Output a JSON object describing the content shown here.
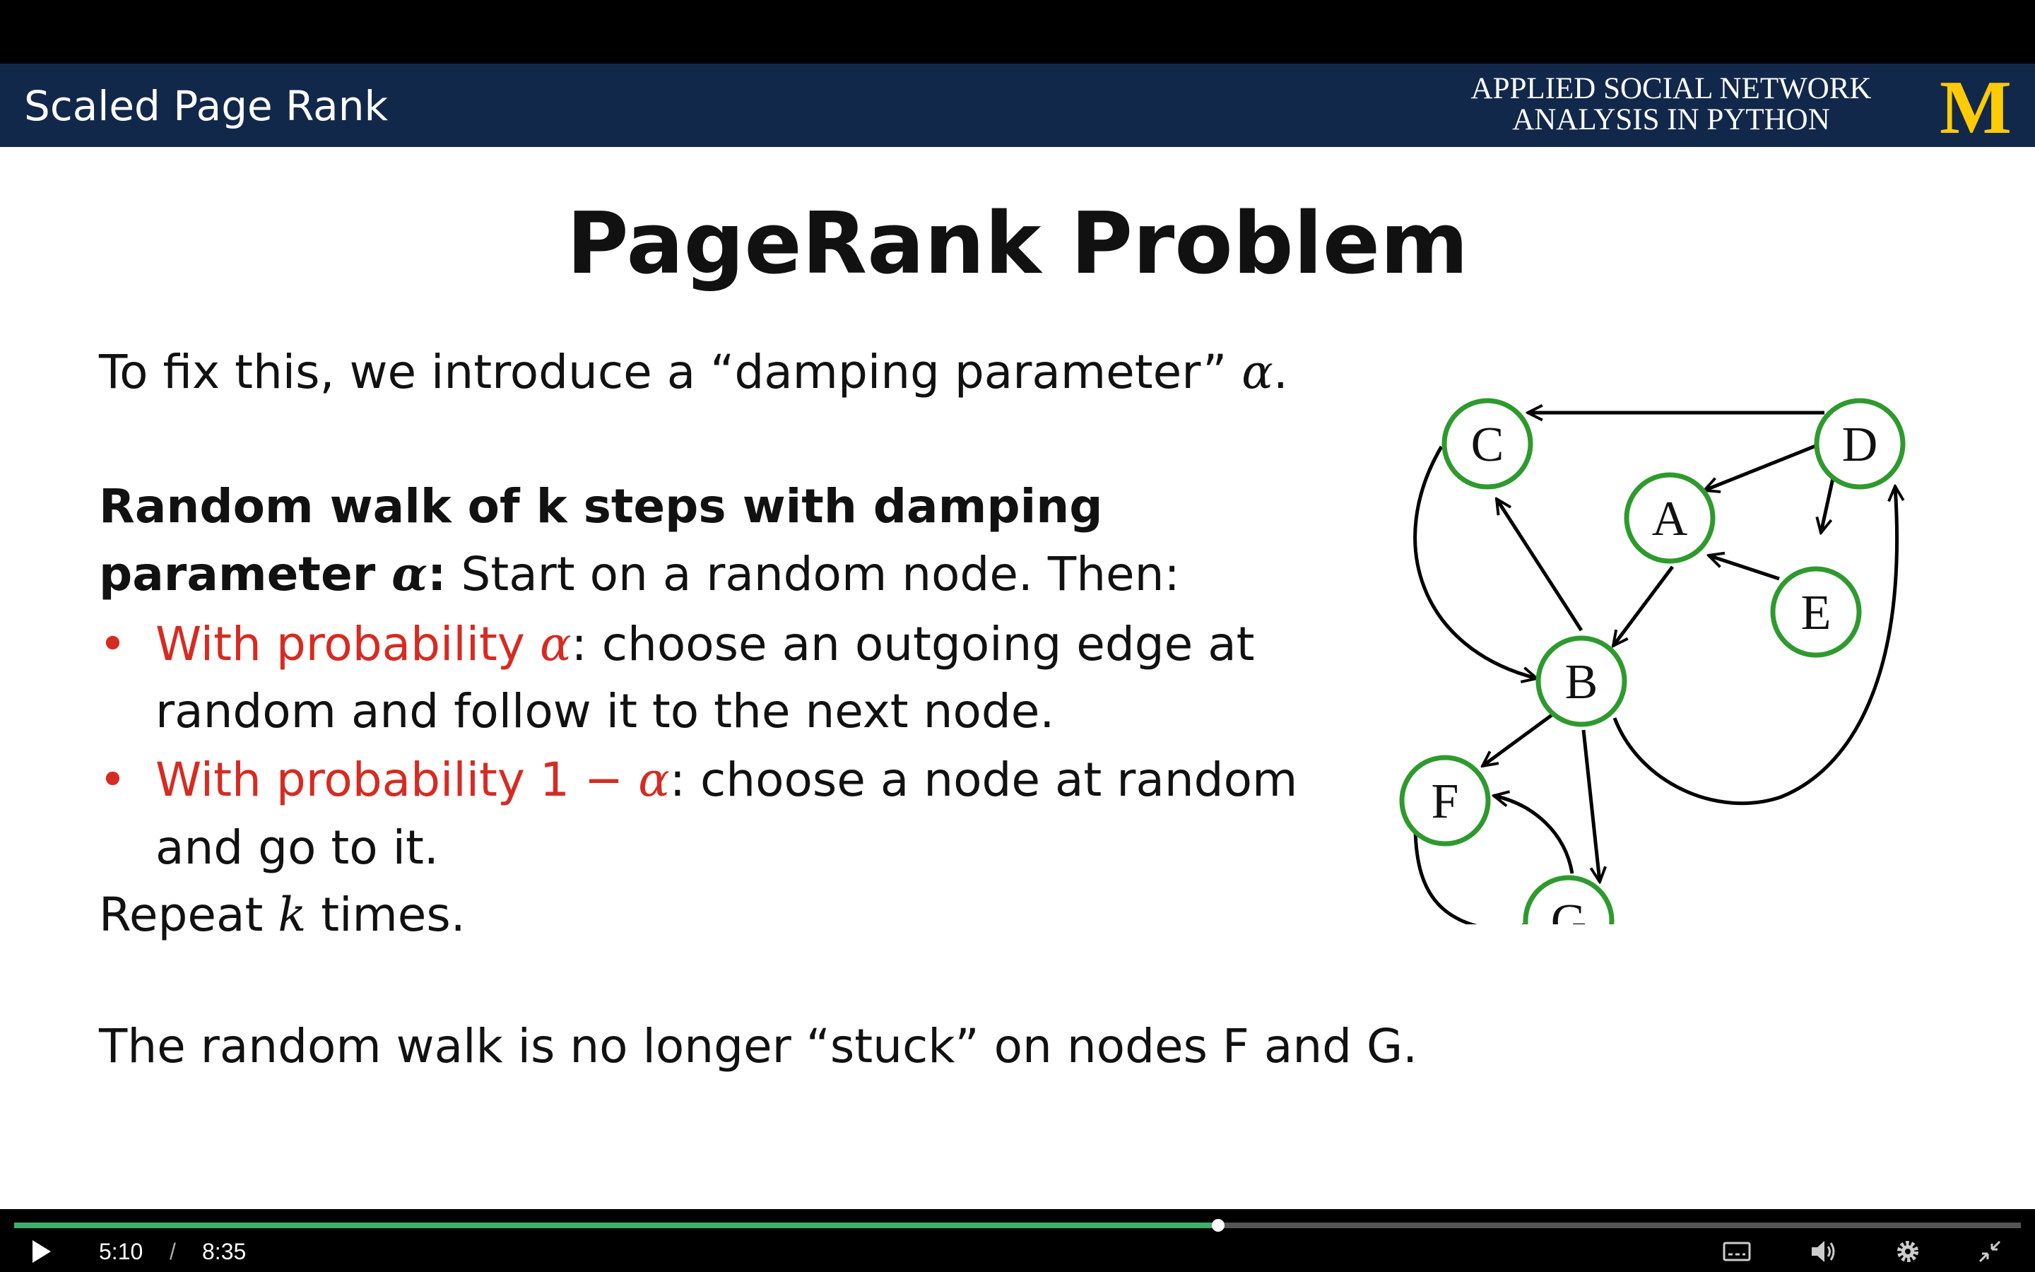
{
  "header": {
    "title": "Scaled Page Rank",
    "course_line1": "APPLIED SOCIAL NETWORK",
    "course_line2": "ANALYSIS IN PYTHON",
    "logo_text": "M",
    "brand_color": "#12284a",
    "logo_color": "#ffcb05"
  },
  "slide": {
    "title": "PageRank Problem",
    "intro_text": "To fix this, we introduce a “damping parameter” ",
    "intro_symbol": "α",
    "intro_end": ".",
    "walk_bold_1": "Random walk of k steps with damping",
    "walk_bold_2": "parameter ",
    "walk_bold_symbol": "α",
    "walk_bold_colon": ":",
    "walk_rest": " Start on a random node.  Then:",
    "bullet_char": "•",
    "bullet1_red": "With probability ",
    "bullet1_symbol": "α",
    "bullet1_text": ": choose an outgoing edge at",
    "bullet1_cont": "random and follow it to the next node.",
    "bullet2_red": "With probability 1 − ",
    "bullet2_symbol": "α",
    "bullet2_text": ": choose a node at random",
    "bullet2_cont": "and go to it.",
    "repeat_a": "Repeat ",
    "repeat_symbol": "k",
    "repeat_b": " times.",
    "conclusion": "The random walk is no longer  “stuck” on nodes F and G.",
    "accent_color": "#d62b22",
    "node_color": "#2e9a2e"
  },
  "graph": {
    "nodes": [
      "C",
      "D",
      "A",
      "E",
      "B",
      "F",
      "G"
    ]
  },
  "player": {
    "current_time": "5:10",
    "separator": "/",
    "duration": "8:35",
    "progress": 0.6
  }
}
